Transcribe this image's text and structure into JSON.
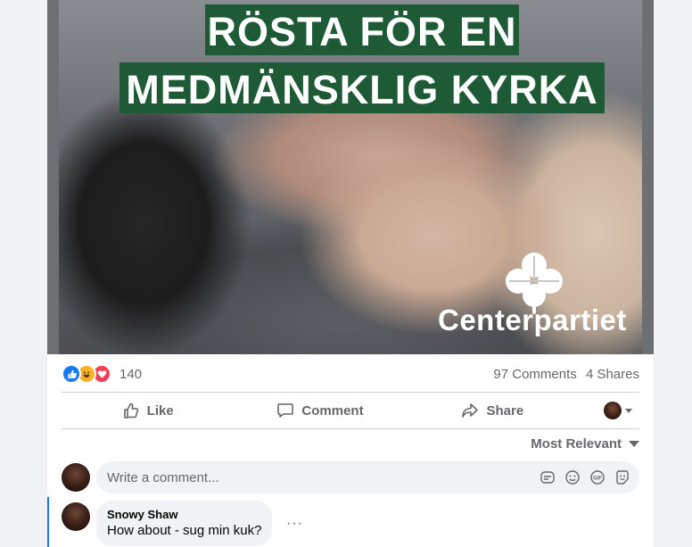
{
  "post": {
    "image": {
      "banner_line1": "RÖSTA FÖR EN",
      "banner_line2": "MEDMÄNSKLIG KYRKA",
      "logo_text": "Centerpartiet"
    },
    "stats": {
      "reaction_count": "140",
      "comments": "97 Comments",
      "shares": "4 Shares"
    },
    "actions": {
      "like": "Like",
      "comment": "Comment",
      "share": "Share"
    },
    "sort_label": "Most Relevant",
    "composer": {
      "placeholder": "Write a comment..."
    },
    "comments": [
      {
        "author": "Snowy Shaw",
        "text": "How about - sug min kuk?",
        "more": "···"
      }
    ]
  },
  "colors": {
    "accent": "#1877f2",
    "banner_green": "#1f5a36",
    "secondary_text": "#65676b"
  },
  "icons": [
    "like-reaction-icon",
    "haha-reaction-icon",
    "love-reaction-icon",
    "thumbs-up-icon",
    "comment-icon",
    "share-icon",
    "sticker-icon",
    "emoji-icon",
    "gif-icon",
    "avatar-sticker-icon"
  ]
}
